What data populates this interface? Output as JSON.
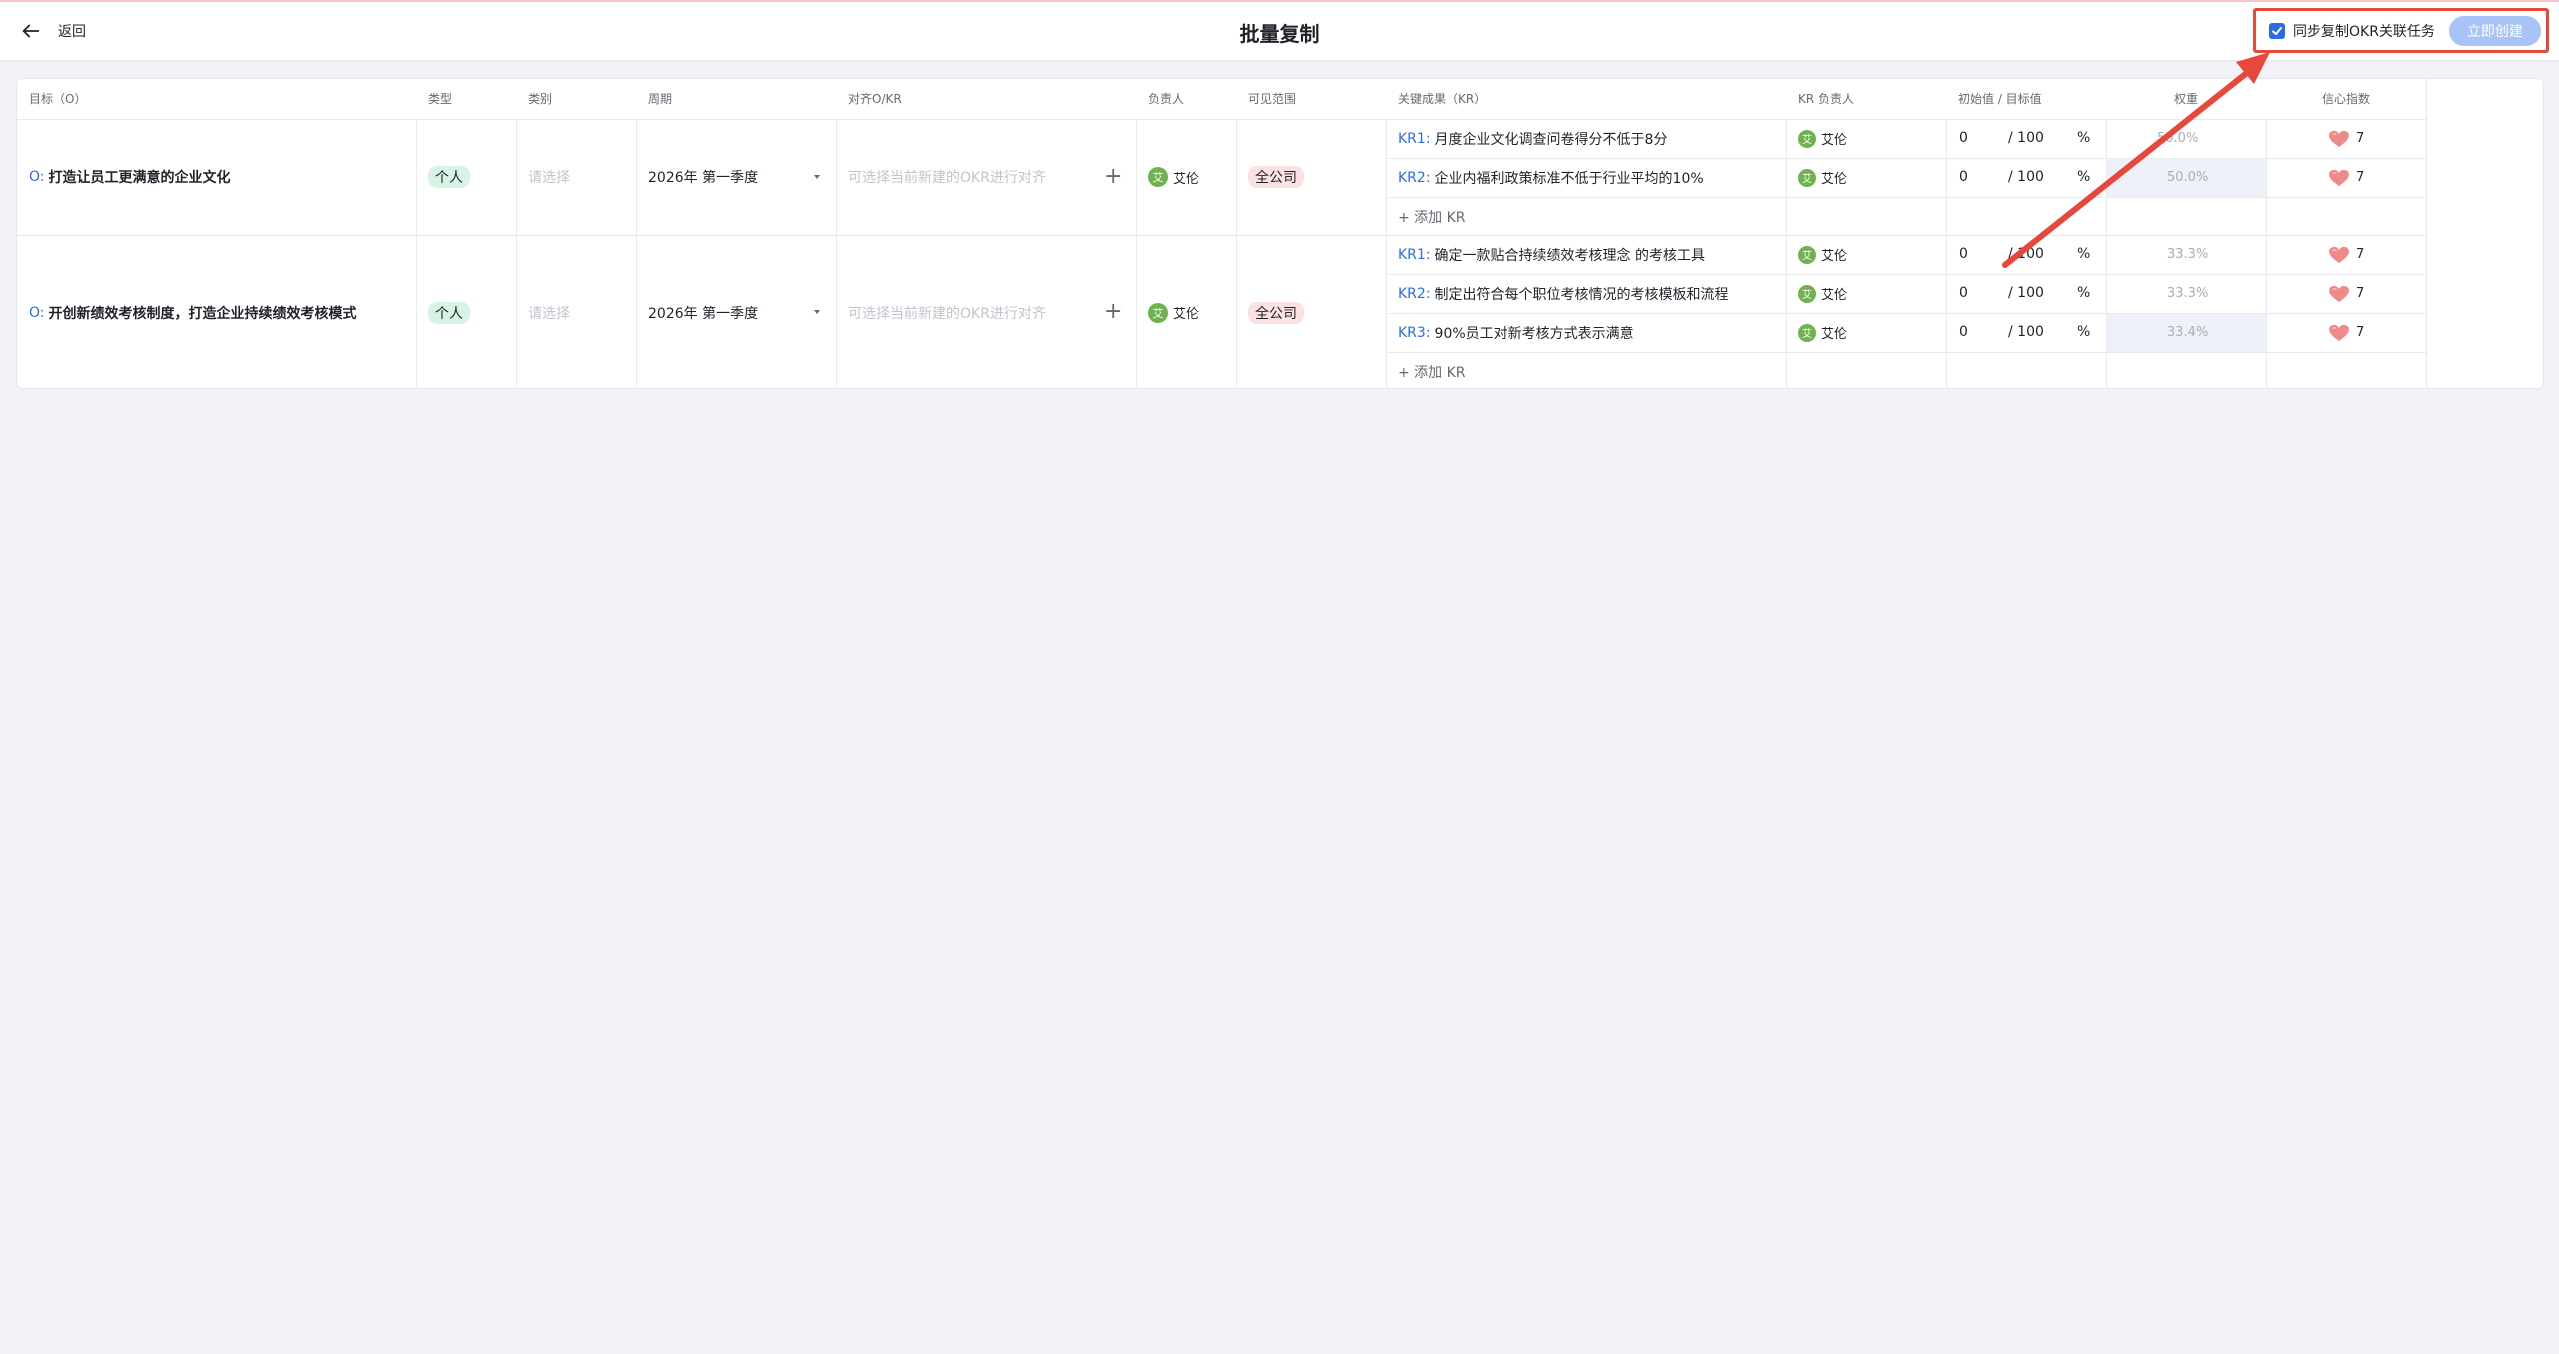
{
  "header": {
    "back_label": "返回",
    "title": "批量复制",
    "sync_label": "同步复制OKR关联任务",
    "sync_checked": true,
    "create_label": "立即创建"
  },
  "table": {
    "headers": [
      "目标（O）",
      "类型",
      "类别",
      "周期",
      "对齐O/KR",
      "负责人",
      "可见范围",
      "关键成果（KR）",
      "KR 负责人",
      "初始值 / 目标值",
      "权重",
      "信心指数"
    ],
    "add_kr_label": "+ 添加 KR",
    "objectives": [
      {
        "prefix": "O:",
        "title": "打造让员工更满意的企业文化",
        "type": "个人",
        "category_placeholder": "请选择",
        "period": "2026年 第一季度",
        "align_placeholder": "可选择当前新建的OKR进行对齐",
        "owner_avatar": "艾",
        "owner": "艾伦",
        "visibility": "全公司",
        "krs": [
          {
            "prefix": "KR1:",
            "text": "月度企业文化调查问卷得分不低于8分",
            "owner_avatar": "艾",
            "owner": "艾伦",
            "initial": "0",
            "target": "/ 100",
            "unit": "%",
            "weight": "50.0%",
            "confidence": "7"
          },
          {
            "prefix": "KR2:",
            "text": "企业内福利政策标准不低于行业平均的10%",
            "owner_avatar": "艾",
            "owner": "艾伦",
            "initial": "0",
            "target": "/ 100",
            "unit": "%",
            "weight": "50.0%",
            "confidence": "7"
          }
        ]
      },
      {
        "prefix": "O:",
        "title": "开创新绩效考核制度，打造企业持续绩效考核模式",
        "type": "个人",
        "category_placeholder": "请选择",
        "period": "2026年 第一季度",
        "align_placeholder": "可选择当前新建的OKR进行对齐",
        "owner_avatar": "艾",
        "owner": "艾伦",
        "visibility": "全公司",
        "krs": [
          {
            "prefix": "KR1:",
            "text": "确定一款贴合持续绩效考核理念 的考核工具",
            "owner_avatar": "艾",
            "owner": "艾伦",
            "initial": "0",
            "target": "/ 100",
            "unit": "%",
            "weight": "33.3%",
            "confidence": "7"
          },
          {
            "prefix": "KR2:",
            "text": "制定出符合每个职位考核情况的考核模板和流程",
            "owner_avatar": "艾",
            "owner": "艾伦",
            "initial": "0",
            "target": "/ 100",
            "unit": "%",
            "weight": "33.3%",
            "confidence": "7"
          },
          {
            "prefix": "KR3:",
            "text": "90%员工对新考核方式表示满意",
            "owner_avatar": "艾",
            "owner": "艾伦",
            "initial": "0",
            "target": "/ 100",
            "unit": "%",
            "weight": "33.4%",
            "confidence": "7"
          }
        ]
      }
    ]
  },
  "colors": {
    "accent": "#2c6de6",
    "annotation": "#e8473c",
    "button_disabled": "#a8c3f5"
  }
}
